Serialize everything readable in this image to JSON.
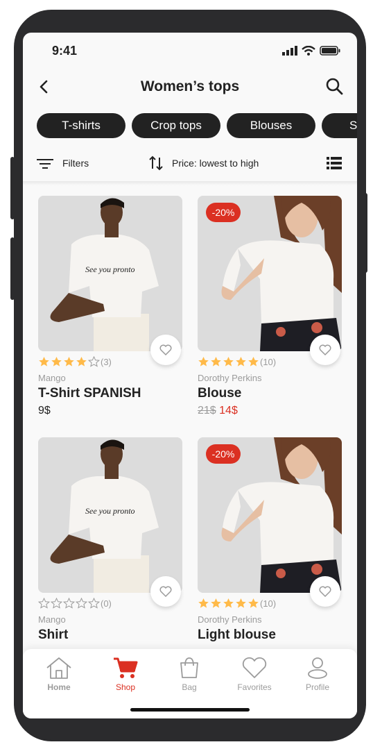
{
  "status": {
    "time": "9:41"
  },
  "header": {
    "title": "Women’s tops"
  },
  "chips": [
    "T-shirts",
    "Crop tops",
    "Blouses",
    "S"
  ],
  "toolbar": {
    "filters": "Filters",
    "sort": "Price: lowest to high"
  },
  "products": [
    {
      "brand": "Mango",
      "name": "T-Shirt SPANISH",
      "price": "9$",
      "old_price": "",
      "new_price": "",
      "rating": 4,
      "reviews": "(3)",
      "discount": "",
      "shirt_text": "See you pronto"
    },
    {
      "brand": "Dorothy Perkins",
      "name": "Blouse",
      "price": "",
      "old_price": "21$",
      "new_price": "14$",
      "rating": 5,
      "reviews": "(10)",
      "discount": "-20%"
    },
    {
      "brand": "Mango",
      "name": "Shirt",
      "price": "",
      "old_price": "",
      "new_price": "",
      "rating": 0,
      "reviews": "(0)",
      "discount": "",
      "shirt_text": "See you pronto"
    },
    {
      "brand": "Dorothy Perkins",
      "name": "Light blouse",
      "price": "",
      "old_price": "",
      "new_price": "",
      "rating": 5,
      "reviews": "(10)",
      "discount": "-20%"
    }
  ],
  "tabs": [
    {
      "label": "Home",
      "icon": "home-icon"
    },
    {
      "label": "Shop",
      "icon": "cart-icon"
    },
    {
      "label": "Bag",
      "icon": "bag-icon"
    },
    {
      "label": "Favorites",
      "icon": "heart-icon"
    },
    {
      "label": "Profile",
      "icon": "profile-icon"
    }
  ],
  "colors": {
    "accent": "#db3022",
    "dark": "#222222",
    "gray": "#9b9b9b",
    "star": "#ffba49"
  }
}
